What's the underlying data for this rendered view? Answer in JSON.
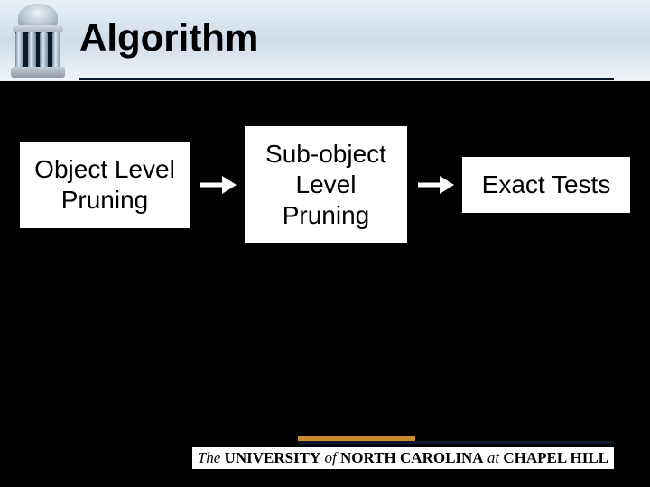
{
  "title": "Algorithm",
  "flow": {
    "boxes": [
      {
        "lines": [
          "Object Level",
          "Pruning"
        ]
      },
      {
        "lines": [
          "Sub-object",
          "Level",
          "Pruning"
        ]
      },
      {
        "lines": [
          "Exact Tests"
        ]
      }
    ]
  },
  "footer": {
    "the": "The",
    "univ": "UNIVERSITY",
    "of": "of",
    "nc": "NORTH  CAROLINA",
    "at": "at",
    "ch": "CHAPEL  HILL"
  },
  "colors": {
    "accent": "#c88a2a",
    "rule": "#0a1a2a"
  }
}
